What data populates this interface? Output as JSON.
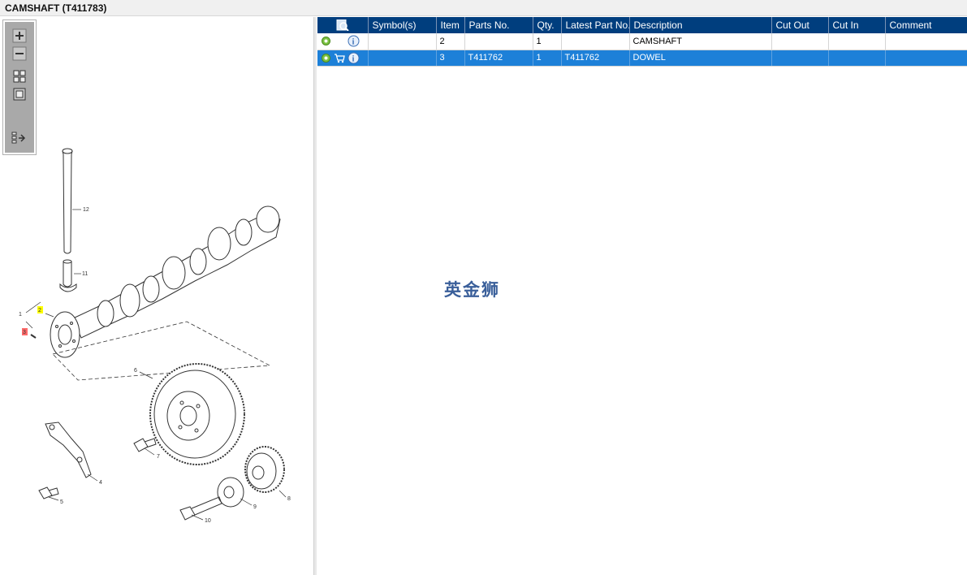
{
  "window": {
    "title": "CAMSHAFT (T411783)"
  },
  "toolbar": {
    "buttons": [
      {
        "name": "zoom-in",
        "icon": "plus-icon"
      },
      {
        "name": "zoom-out",
        "icon": "minus-icon"
      },
      {
        "name": "fit-all",
        "icon": "grid-icon"
      },
      {
        "name": "actual-size",
        "icon": "square-icon"
      },
      {
        "name": "export",
        "icon": "list-arrow-icon"
      }
    ]
  },
  "diagram": {
    "callouts": [
      "12",
      "11",
      "1",
      "2",
      "3",
      "6",
      "7",
      "4",
      "5",
      "8",
      "9",
      "10"
    ],
    "highlight_colors": {
      "item2": "#ffff00",
      "item3": "#ff6b6b"
    }
  },
  "table": {
    "headers": [
      "Symbol(s)",
      "Item",
      "Parts No.",
      "Qty.",
      "Latest Part No.",
      "Description",
      "Cut Out",
      "Cut In",
      "Comment"
    ],
    "rows": [
      {
        "symbols": "",
        "item": "2",
        "parts_no": "",
        "qty": "1",
        "latest_part_no": "",
        "description": "CAMSHAFT",
        "cut_out": "",
        "cut_in": "",
        "comment": "",
        "selected": false,
        "has_cart": false
      },
      {
        "symbols": "",
        "item": "3",
        "parts_no": "T411762",
        "qty": "1",
        "latest_part_no": "T411762",
        "description": "DOWEL",
        "cut_out": "",
        "cut_in": "",
        "comment": "",
        "selected": true,
        "has_cart": true
      }
    ]
  },
  "watermark": "英金狮",
  "colors": {
    "header_bg": "#003e7e",
    "selected_row": "#1d80d8",
    "title_bg": "#f0f0f0"
  }
}
